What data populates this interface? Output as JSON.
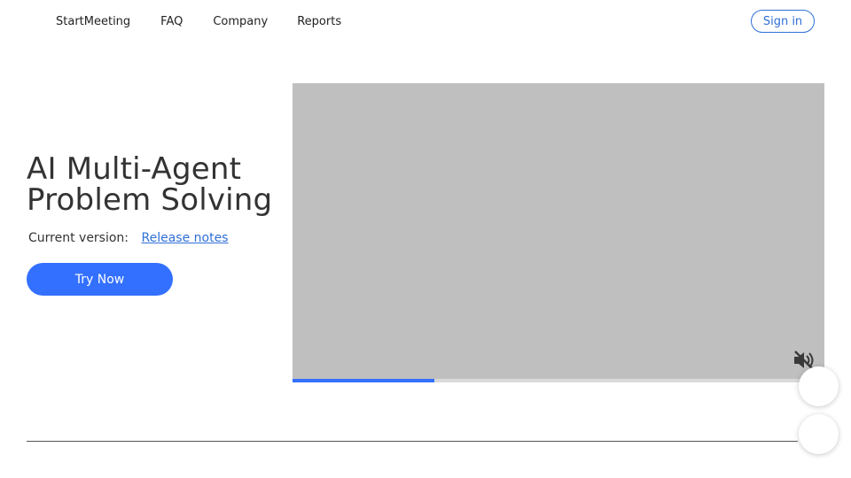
{
  "nav": {
    "links": [
      "StartMeeting",
      "FAQ",
      "Company",
      "Reports"
    ],
    "signin_label": "Sign in"
  },
  "hero": {
    "title_line1": "AI Multi-Agent",
    "title_line2": "Problem Solving",
    "version_label": "Current version:",
    "release_notes_label": "Release notes",
    "try_label": "Try Now"
  },
  "video": {
    "progress_fraction": 0.267,
    "muted": true,
    "mute_icon": "speaker-muted-icon"
  },
  "colors": {
    "accent": "#3370ff",
    "link": "#2f6fd6",
    "video_bg": "#bfbfbf"
  }
}
